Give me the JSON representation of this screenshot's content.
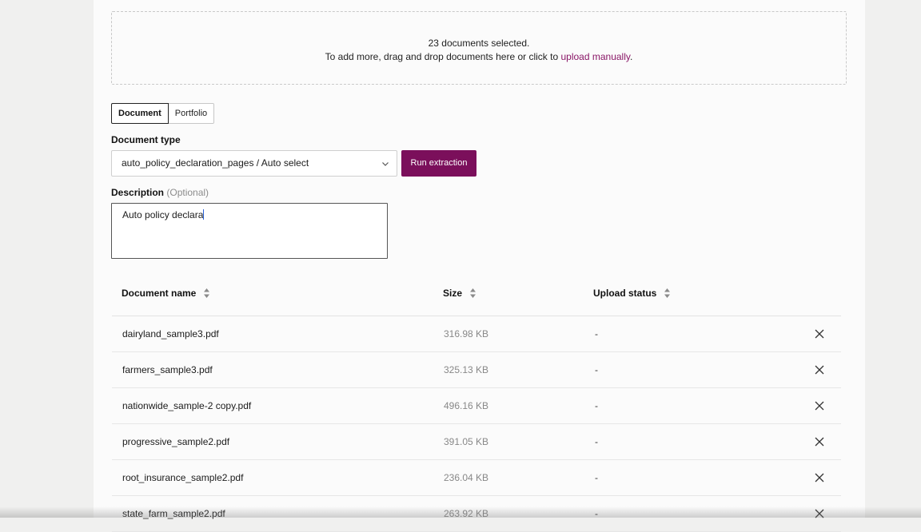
{
  "dropzone": {
    "line1": "23 documents selected.",
    "line2_prefix": "To add more, drag and drop documents here or click to ",
    "link": "upload manually",
    "line2_suffix": "."
  },
  "tabs": [
    {
      "label": "Document",
      "active": true
    },
    {
      "label": "Portfolio",
      "active": false
    }
  ],
  "document_type": {
    "label": "Document type",
    "selected": "auto_policy_declaration_pages / Auto select",
    "icon": "chevron-down-icon"
  },
  "run_button": {
    "label": "Run extraction",
    "color": "#7b0f5b"
  },
  "description": {
    "label": "Description",
    "optional": "(Optional)",
    "value": "Auto policy declara"
  },
  "table": {
    "headers": {
      "name": "Document name",
      "size": "Size",
      "status": "Upload status"
    },
    "rows": [
      {
        "name": "dairyland_sample3.pdf",
        "size": "316.98 KB",
        "status": "-"
      },
      {
        "name": "farmers_sample3.pdf",
        "size": "325.13 KB",
        "status": "-"
      },
      {
        "name": "nationwide_sample-2 copy.pdf",
        "size": "496.16 KB",
        "status": "-"
      },
      {
        "name": "progressive_sample2.pdf",
        "size": "391.05 KB",
        "status": "-"
      },
      {
        "name": "root_insurance_sample2.pdf",
        "size": "236.04 KB",
        "status": "-"
      },
      {
        "name": "state_farm_sample2.pdf",
        "size": "263.92 KB",
        "status": "-"
      }
    ]
  }
}
